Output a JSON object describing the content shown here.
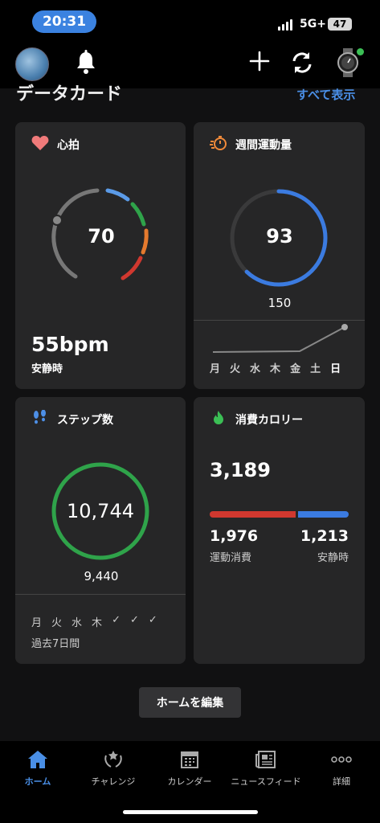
{
  "status": {
    "time": "20:31",
    "network": "5G+",
    "battery": "47"
  },
  "section": {
    "title": "データカード",
    "show_all": "すべて表示"
  },
  "heart": {
    "title": "心拍",
    "value": "70",
    "resting": "55bpm",
    "resting_label": "安静時"
  },
  "weekly": {
    "title": "週間運動量",
    "value": "93",
    "goal": "150",
    "days": [
      "月",
      "火",
      "水",
      "木",
      "金",
      "土",
      "日"
    ]
  },
  "steps": {
    "title": "ステップ数",
    "value": "10,744",
    "goal": "9,440",
    "days": [
      "月",
      "火",
      "水",
      "木",
      "✓",
      "✓",
      "✓"
    ],
    "period": "過去7日間"
  },
  "calories": {
    "title": "消費カロリー",
    "total": "3,189",
    "active": "1,976",
    "active_label": "運動消費",
    "resting": "1,213",
    "resting_label": "安静時",
    "active_ratio": 0.62,
    "colors": {
      "active": "#d0382f",
      "resting": "#3b7be0"
    }
  },
  "edit_button": "ホームを編集",
  "tabs": [
    {
      "label": "ホーム"
    },
    {
      "label": "チャレンジ"
    },
    {
      "label": "カレンダー"
    },
    {
      "label": "ニュースフィード"
    },
    {
      "label": "詳細"
    }
  ],
  "colors": {
    "accent": "#3b82e0",
    "heart_gauge": [
      "#3b82e0",
      "#2fa34a",
      "#e57a2e",
      "#d0382f"
    ],
    "steps_ring": "#2fa34a",
    "weekly_ring": "#3b7be0"
  },
  "weekly_progress_fraction": 0.62
}
